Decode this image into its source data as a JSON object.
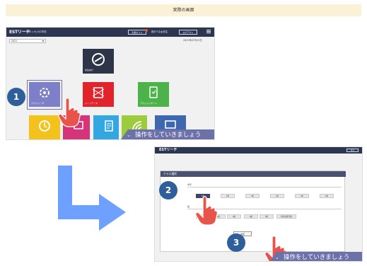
{
  "header": {
    "title": "実際の画面"
  },
  "top_screen": {
    "logo": "ESTリーチ",
    "school": "ベネッセ小中学校",
    "print_button": "利用ガイド",
    "teacher": "田中ベネ太先生",
    "logout_button": "ログアウト",
    "year_select": "2021",
    "date": "2021年07月13日",
    "tiles": [
      {
        "label": "先生向け",
        "color": "#2e3549",
        "icon": "target-icon"
      },
      {
        "label": "クラスリーダ",
        "color": "#7d7fc8",
        "icon": "class-icon"
      },
      {
        "label": "シートデータ",
        "color": "#e1232b",
        "icon": "network-icon"
      },
      {
        "label": "アクションボード",
        "color": "#4bb34a",
        "icon": "tablet-icon"
      },
      {
        "label": "",
        "color": "#f3c21b",
        "icon": "clock-icon"
      },
      {
        "label": "",
        "color": "#d63479",
        "icon": "chart-icon"
      },
      {
        "label": "",
        "color": "#35a7e0",
        "icon": "doc-icon"
      },
      {
        "label": "",
        "color": "#9ccb3b",
        "icon": "signal-icon"
      },
      {
        "label": "",
        "color": "#3d68b0",
        "icon": "monitor-icon"
      }
    ]
  },
  "bottom_screen": {
    "logo": "ESTリーチ",
    "back_button": "戻る",
    "dialog_title": "クラス選択",
    "section1_label": "学年",
    "grade_buttons": [
      "1年",
      "2年",
      "3年",
      "4年",
      "5年",
      "6年"
    ],
    "section2_label": "組",
    "class_buttons": [
      "1組",
      "2組",
      "3組",
      "4組",
      "5組",
      "特別支援学級"
    ],
    "decide_button": "決定"
  },
  "badges": [
    "1",
    "2",
    "3"
  ],
  "banner_text": "操作をしていきましょう",
  "colors": {
    "accent": "#2f5f9a",
    "arrow": "#6ea0ff",
    "banner": "#6d71a9",
    "header_bg": "#fbf1d6"
  }
}
